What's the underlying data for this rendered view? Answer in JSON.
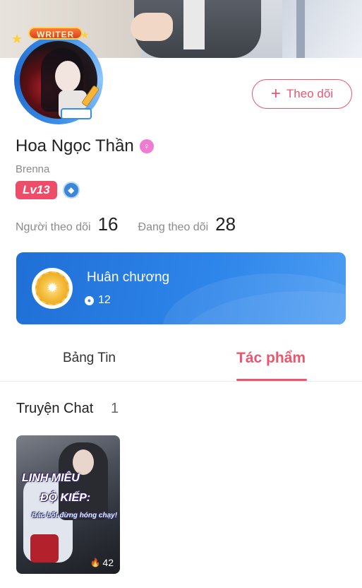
{
  "profile": {
    "badge_text": "WRITER",
    "follow_label": "Theo dõi",
    "name": "Hoa Ngọc Thần",
    "username": "Brenna",
    "level": "Lv13",
    "gender_icon": "female-symbol"
  },
  "stats": {
    "followers_label": "Người theo dõi",
    "followers_value": "16",
    "following_label": "Đang theo dõi",
    "following_value": "28"
  },
  "medal": {
    "title": "Huân chương",
    "count": "12"
  },
  "tabs": [
    {
      "label": "Bảng Tin",
      "active": false
    },
    {
      "label": "Tác phẩm",
      "active": true
    }
  ],
  "works": {
    "section_title": "Truyện Chat",
    "section_count": "1",
    "items": [
      {
        "title_line1": "LINH MIÊU",
        "title_line2": "ĐỘ KIẾP:",
        "subtitle": "Bác bốt đừng hóng chạy!",
        "views": "42"
      }
    ]
  },
  "colors": {
    "accent": "#e9566f",
    "medal_card": "#2f86ea",
    "level_badge": "#ee4d6a"
  }
}
